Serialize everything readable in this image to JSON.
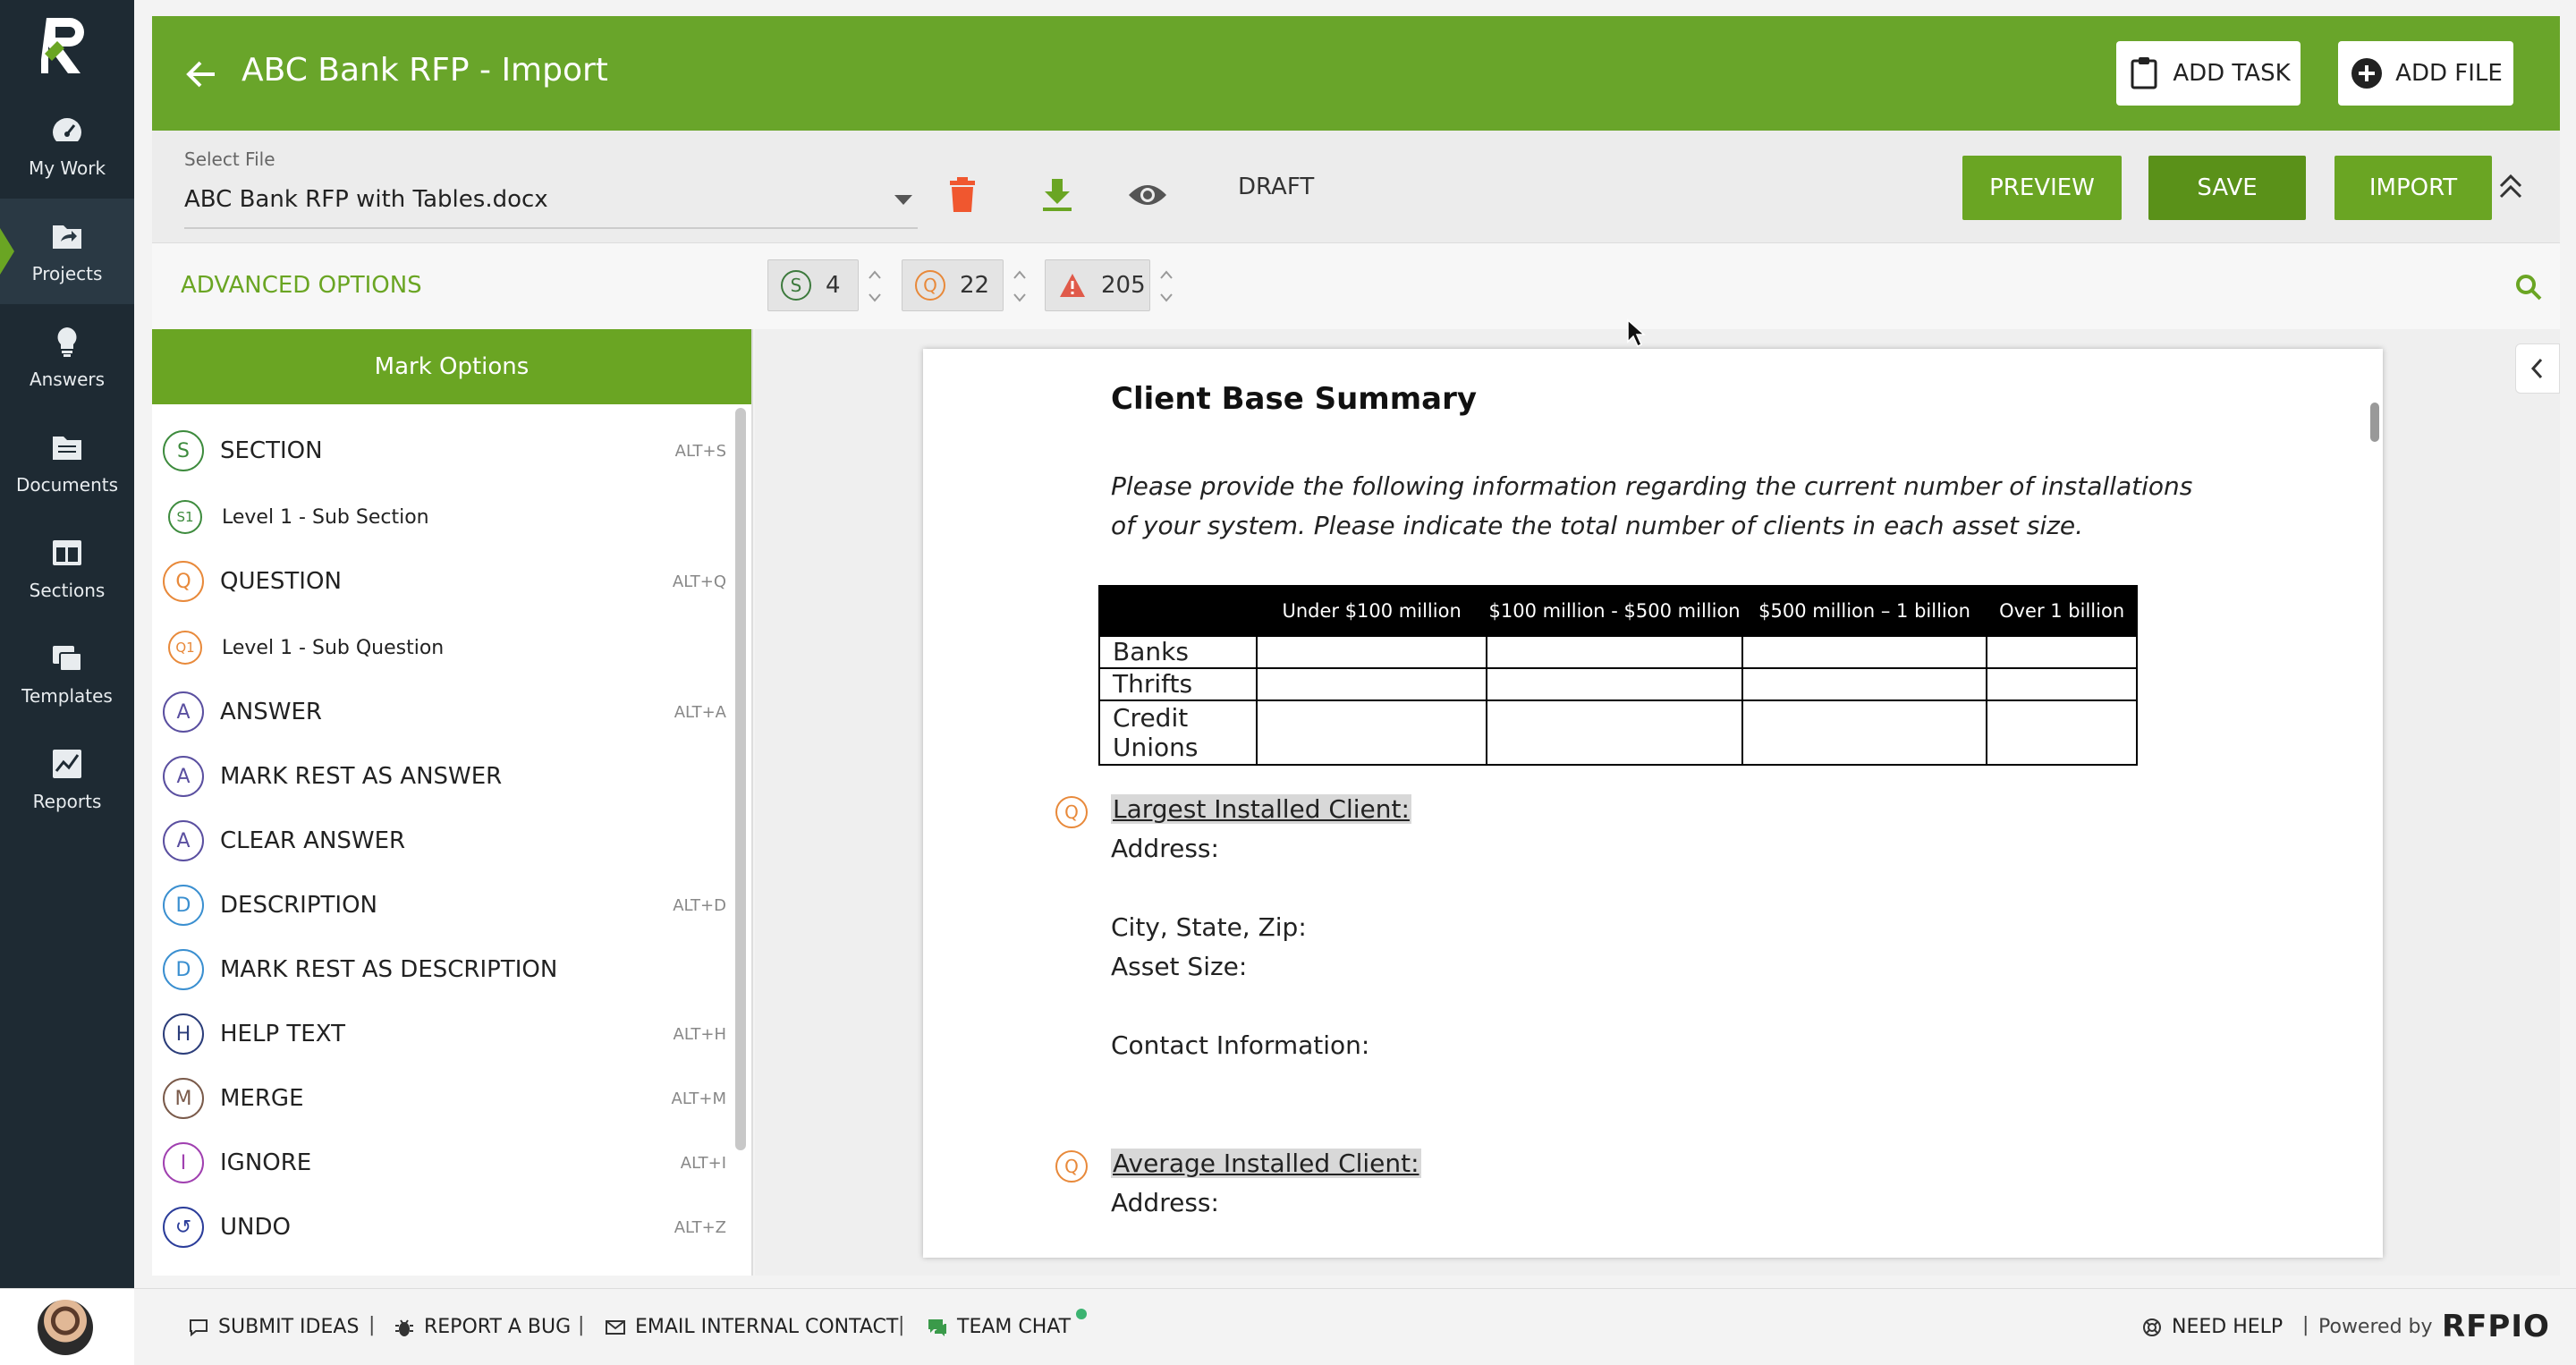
{
  "nav": {
    "items": [
      {
        "label": "My Work",
        "icon": "gauge-icon"
      },
      {
        "label": "Projects",
        "icon": "folder-share-icon"
      },
      {
        "label": "Answers",
        "icon": "lightbulb-icon"
      },
      {
        "label": "Documents",
        "icon": "documents-icon"
      },
      {
        "label": "Sections",
        "icon": "sections-icon"
      },
      {
        "label": "Templates",
        "icon": "templates-icon"
      },
      {
        "label": "Reports",
        "icon": "reports-icon"
      }
    ],
    "active": "Projects"
  },
  "header": {
    "title": "ABC Bank RFP - Import",
    "add_task": "ADD TASK",
    "add_file": "ADD FILE"
  },
  "filebar": {
    "select_label": "Select File",
    "selected_file": "ABC Bank RFP with Tables.docx",
    "status": "DRAFT",
    "preview": "PREVIEW",
    "save": "SAVE",
    "import": "IMPORT"
  },
  "options": {
    "advanced": "ADVANCED OPTIONS",
    "counters": [
      {
        "badge": "S",
        "value": "4",
        "color": "#3d7a3d"
      },
      {
        "badge": "Q",
        "value": "22",
        "color": "#e8893a"
      },
      {
        "badge": "!",
        "value": "205",
        "color": "#e05a4a"
      }
    ]
  },
  "mark_panel": {
    "title": "Mark Options",
    "items": [
      {
        "badge": "S",
        "label": "SECTION",
        "shortcut": "ALT+S",
        "color": "#3d8b3d",
        "small": false,
        "sub": false
      },
      {
        "badge": "S1",
        "label": "Level 1 - Sub Section",
        "shortcut": "",
        "color": "#3d8b3d",
        "small": true,
        "sub": true
      },
      {
        "badge": "Q",
        "label": "QUESTION",
        "shortcut": "ALT+Q",
        "color": "#e8893a",
        "small": false,
        "sub": false
      },
      {
        "badge": "Q1",
        "label": "Level 1 - Sub Question",
        "shortcut": "",
        "color": "#e8893a",
        "small": true,
        "sub": true
      },
      {
        "badge": "A",
        "label": "ANSWER",
        "shortcut": "ALT+A",
        "color": "#5a4fa0",
        "small": false,
        "sub": false
      },
      {
        "badge": "A",
        "label": "MARK REST AS ANSWER",
        "shortcut": "",
        "color": "#5a4fa0",
        "small": false,
        "sub": false
      },
      {
        "badge": "A",
        "label": "CLEAR ANSWER",
        "shortcut": "",
        "color": "#5a4fa0",
        "small": false,
        "sub": false
      },
      {
        "badge": "D",
        "label": "DESCRIPTION",
        "shortcut": "ALT+D",
        "color": "#3a8fd0",
        "small": false,
        "sub": false
      },
      {
        "badge": "D",
        "label": "MARK REST AS DESCRIPTION",
        "shortcut": "",
        "color": "#3a8fd0",
        "small": false,
        "sub": false
      },
      {
        "badge": "H",
        "label": "HELP TEXT",
        "shortcut": "ALT+H",
        "color": "#2b3d7a",
        "small": false,
        "sub": false
      },
      {
        "badge": "M",
        "label": "MERGE",
        "shortcut": "ALT+M",
        "color": "#7a5a4a",
        "small": false,
        "sub": false
      },
      {
        "badge": "I",
        "label": "IGNORE",
        "shortcut": "ALT+I",
        "color": "#a040b0",
        "small": false,
        "sub": false
      },
      {
        "badge": "↺",
        "label": "UNDO",
        "shortcut": "ALT+Z",
        "color": "#2b3d9a",
        "small": false,
        "sub": false
      }
    ]
  },
  "document": {
    "title": "Client Base Summary",
    "intro": "Please provide the following information regarding the current number of installations of your system. Please indicate the total number of clients in each asset size.",
    "table": {
      "headers": [
        "",
        "Under $100 million",
        "$100 million - $500 million",
        "$500 million – 1 billion",
        "Over 1 billion"
      ],
      "rows": [
        "Banks",
        "Thrifts",
        "Credit Unions"
      ]
    },
    "q1": "Largest Installed Client:",
    "q1_fields": [
      "Address:",
      "City, State, Zip:",
      "Asset Size:",
      "Contact Information:"
    ],
    "q2": "Average Installed Client:",
    "q2_fields": [
      "Address:"
    ],
    "q_badge": "Q"
  },
  "footer": {
    "submit_ideas": "SUBMIT IDEAS",
    "report_bug": "REPORT A BUG",
    "email_contact": "EMAIL INTERNAL CONTACT",
    "team_chat": "TEAM CHAT",
    "need_help": "NEED HELP",
    "powered_by": "Powered by",
    "brand": "RFPIO",
    "separator": "|"
  }
}
